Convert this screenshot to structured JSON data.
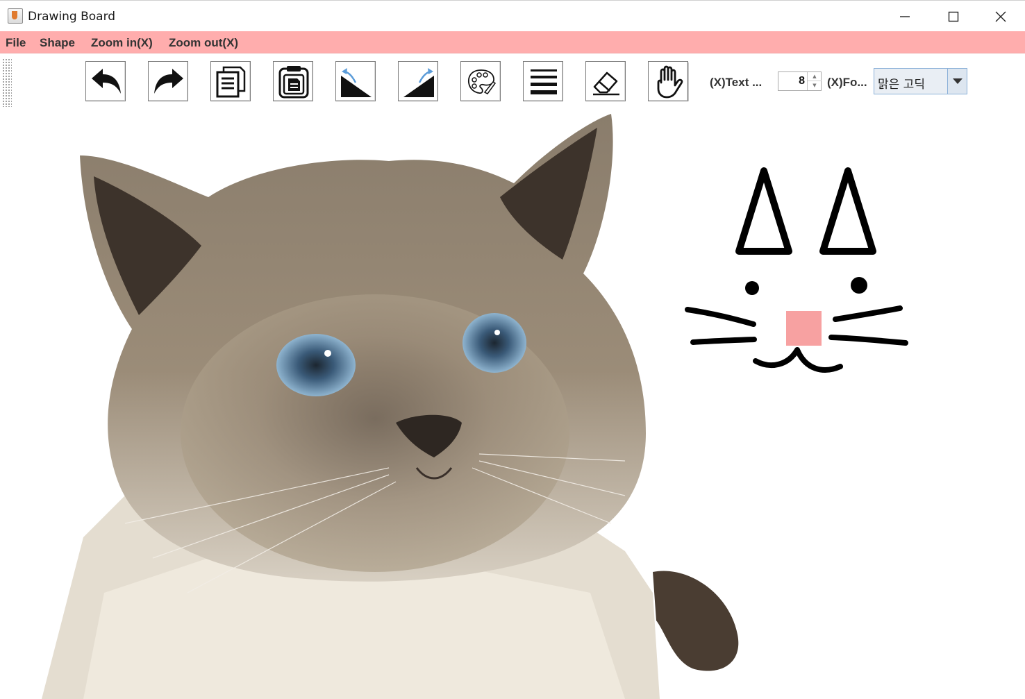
{
  "window": {
    "title": "Drawing Board",
    "controls": [
      "minimize-icon",
      "maximize-icon",
      "close-icon"
    ]
  },
  "menu": {
    "items": [
      "File",
      "Shape",
      "Zoom in(X)",
      "Zoom out(X)"
    ],
    "background": "#ffadad"
  },
  "toolbar": {
    "tools": [
      {
        "name": "undo",
        "icon": "undo-arrow-icon"
      },
      {
        "name": "redo",
        "icon": "redo-arrow-icon"
      },
      {
        "name": "copy",
        "icon": "copy-document-icon"
      },
      {
        "name": "paste",
        "icon": "paste-clipboard-icon"
      },
      {
        "name": "rotate-left",
        "icon": "rotate-left-triangle-icon"
      },
      {
        "name": "rotate-right",
        "icon": "rotate-right-triangle-icon"
      },
      {
        "name": "color",
        "icon": "palette-icon"
      },
      {
        "name": "line-width",
        "icon": "line-thickness-icon"
      },
      {
        "name": "eraser",
        "icon": "eraser-icon"
      },
      {
        "name": "pan",
        "icon": "hand-icon"
      }
    ],
    "text_size_label": "(X)Text ...",
    "text_size_value": "8",
    "font_label": "(X)Fo...",
    "font_value": "맑은 고딕"
  },
  "canvas": {
    "content": [
      "cat-photo-image",
      "cat-face-drawing"
    ],
    "nose_color": "#f7a1a1",
    "stroke_color": "#000000"
  }
}
